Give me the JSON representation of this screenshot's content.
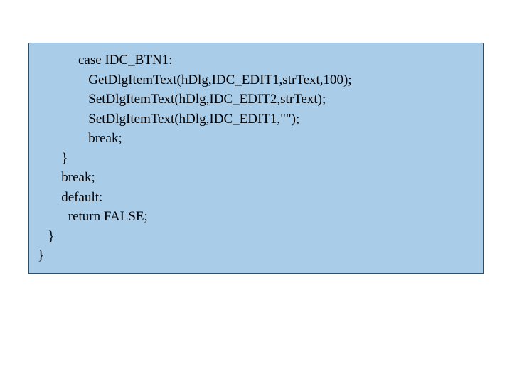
{
  "code": {
    "lines": [
      "            case IDC_BTN1:",
      "               GetDlgItemText(hDlg,IDC_EDIT1,strText,100);",
      "               SetDlgItemText(hDlg,IDC_EDIT2,strText);",
      "               SetDlgItemText(hDlg,IDC_EDIT1,\"\");",
      "               break;",
      "       }",
      "       break;",
      "       default:",
      "         return FALSE;",
      "   }",
      "}"
    ]
  }
}
